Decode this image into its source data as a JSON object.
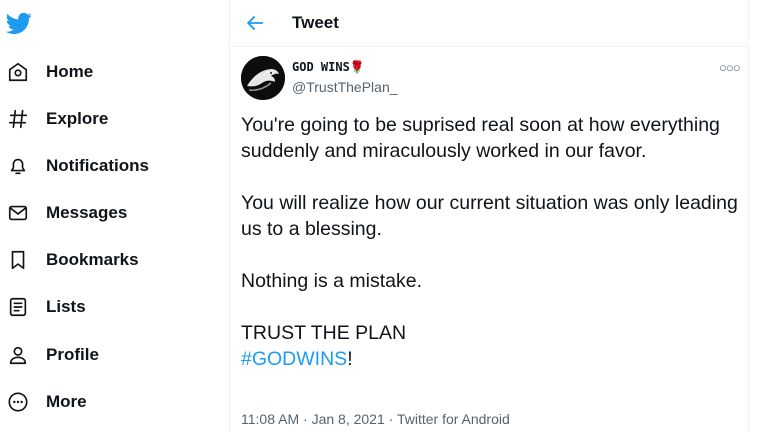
{
  "brand_color": "#1d9bf0",
  "logo_icon": "twitter-bird-icon",
  "nav": [
    {
      "label": "Home",
      "icon": "home-icon"
    },
    {
      "label": "Explore",
      "icon": "hashtag-icon"
    },
    {
      "label": "Notifications",
      "icon": "bell-icon"
    },
    {
      "label": "Messages",
      "icon": "envelope-icon"
    },
    {
      "label": "Bookmarks",
      "icon": "bookmark-icon"
    },
    {
      "label": "Lists",
      "icon": "list-icon"
    },
    {
      "label": "Profile",
      "icon": "person-icon"
    },
    {
      "label": "More",
      "icon": "more-circle-icon"
    }
  ],
  "header": {
    "title": "Tweet",
    "back_icon": "back-arrow-icon"
  },
  "tweet": {
    "author_name": "GOD WINS🌹",
    "author_handle": "@TrustThePlan_",
    "avatar": "eagle-avatar",
    "more_icon": "more-dots-icon",
    "paragraph1": "You're going to be suprised real soon at how everything suddenly and miraculously worked in our favor.",
    "paragraph2": "You will realize how our current situation was only leading us to a blessing.",
    "paragraph3": "Nothing is a mistake.",
    "paragraph4": "TRUST THE PLAN",
    "hashtag": "#GODWINS",
    "hashtag_suffix": "!",
    "time": "11:08 AM",
    "date": "Jan 8, 2021",
    "separator": " · ",
    "source": "Twitter for Android"
  }
}
